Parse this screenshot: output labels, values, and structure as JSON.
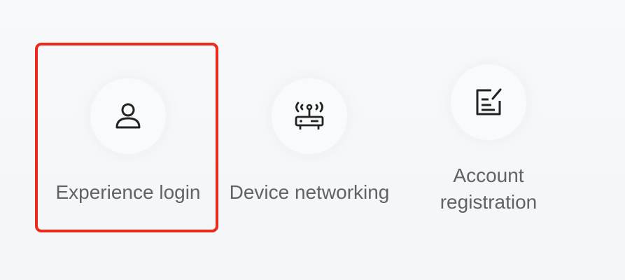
{
  "options": [
    {
      "label": "Experience login",
      "icon": "user-icon"
    },
    {
      "label": "Device networking",
      "icon": "router-icon"
    },
    {
      "label": "Account registration",
      "label_lines": [
        "Account",
        "registration"
      ],
      "icon": "edit-document-icon"
    }
  ],
  "colors": {
    "highlight": "#ec2a1c",
    "label": "#5f6266",
    "icon": "#222222",
    "background": "#f5f7f8"
  }
}
